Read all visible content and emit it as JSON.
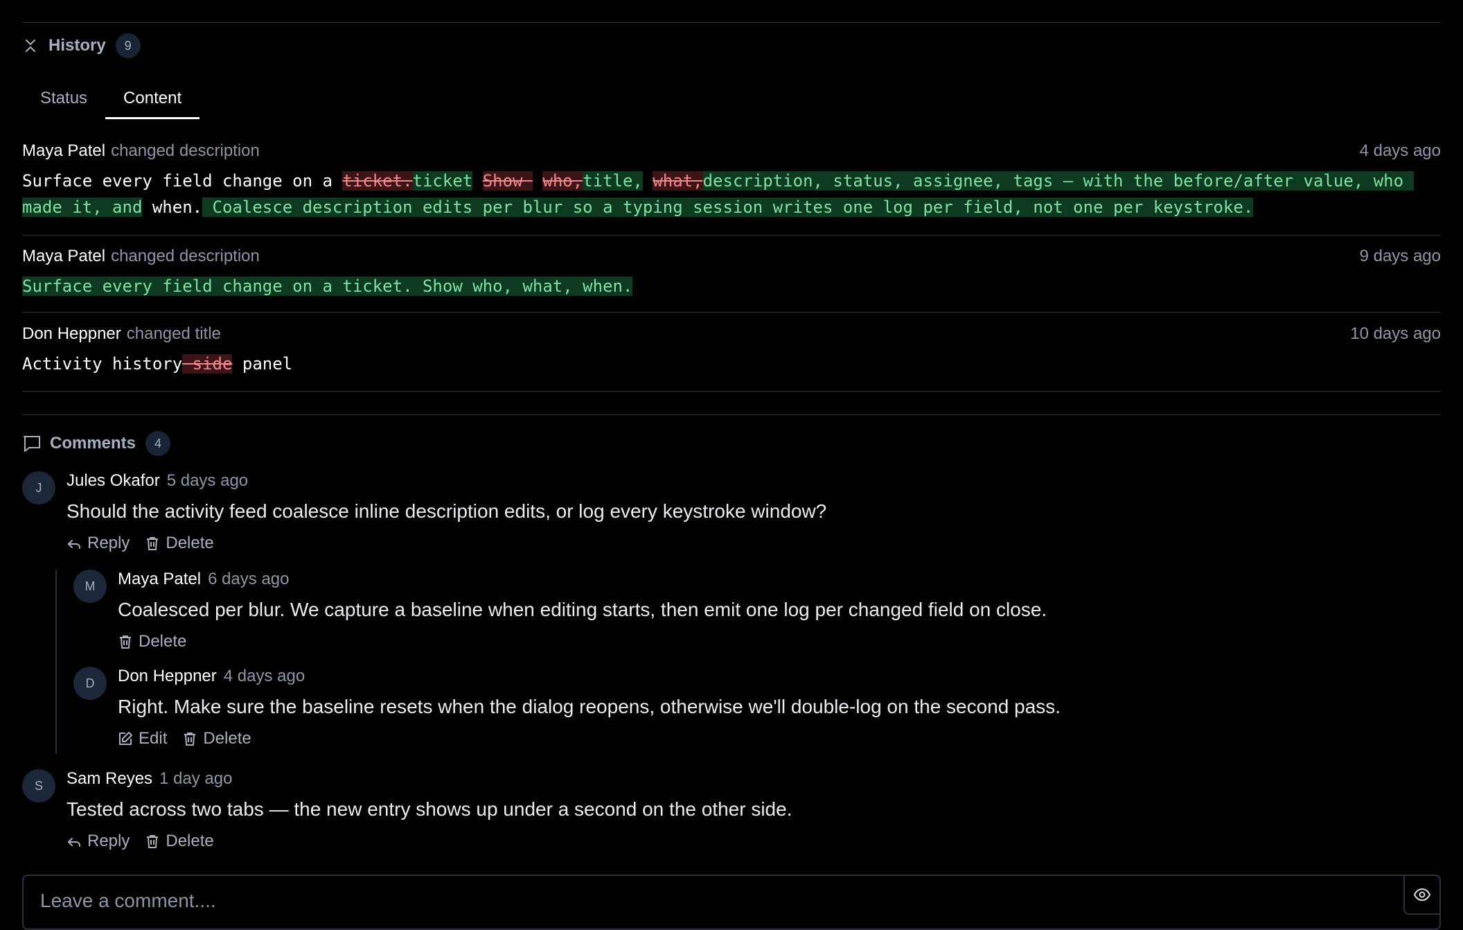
{
  "history": {
    "title": "History",
    "count": "9",
    "tabs": [
      {
        "label": "Status"
      },
      {
        "label": "Content"
      }
    ],
    "entries": [
      {
        "author": "Maya Patel",
        "action": "changed description",
        "time": "4 days ago",
        "diff": [
          {
            "t": "eq",
            "s": "Surface every field change on a "
          },
          {
            "t": "del",
            "s": "ticket."
          },
          {
            "t": "add",
            "s": "ticket"
          },
          {
            "t": "eq",
            "s": " "
          },
          {
            "t": "del",
            "s": "Show "
          },
          {
            "t": "eq",
            "s": " "
          },
          {
            "t": "del",
            "s": "who,"
          },
          {
            "t": "add",
            "s": "title,"
          },
          {
            "t": "eq",
            "s": " "
          },
          {
            "t": "del",
            "s": "what,"
          },
          {
            "t": "add",
            "s": "description, status, assignee, tags — with the before/after value, who made it, and"
          },
          {
            "t": "eq",
            "s": " when."
          },
          {
            "t": "add",
            "s": " Coalesce description edits per blur so a typing session writes one log per field, not one per keystroke."
          }
        ]
      },
      {
        "author": "Maya Patel",
        "action": "changed description",
        "time": "9 days ago",
        "diff": [
          {
            "t": "add",
            "s": "Surface every field change on a ticket. Show who, what, when."
          }
        ]
      },
      {
        "author": "Don Heppner",
        "action": "changed title",
        "time": "10 days ago",
        "diff": [
          {
            "t": "eq",
            "s": "Activity history"
          },
          {
            "t": "del",
            "s": " side"
          },
          {
            "t": "eq",
            "s": " panel"
          }
        ]
      }
    ]
  },
  "comments": {
    "title": "Comments",
    "count": "4",
    "items": [
      {
        "initial": "J",
        "author": "Jules Okafor",
        "time": "5 days ago",
        "text": "Should the activity feed coalesce inline description edits, or log every keystroke window?",
        "reply": "Reply",
        "delete": "Delete"
      },
      {
        "initial": "M",
        "author": "Maya Patel",
        "time": "6 days ago",
        "text": "Coalesced per blur. We capture a baseline when editing starts, then emit one log per changed field on close.",
        "delete": "Delete"
      },
      {
        "initial": "D",
        "author": "Don Heppner",
        "time": "4 days ago",
        "text": "Right. Make sure the baseline resets when the dialog reopens, otherwise we'll double-log on the second pass.",
        "edit": "Edit",
        "delete": "Delete"
      },
      {
        "initial": "S",
        "author": "Sam Reyes",
        "time": "1 day ago",
        "text": "Tested across two tabs — the new entry shows up under a second on the other side.",
        "reply": "Reply",
        "delete": "Delete"
      }
    ]
  },
  "composer": {
    "placeholder": "Leave a comment...."
  }
}
